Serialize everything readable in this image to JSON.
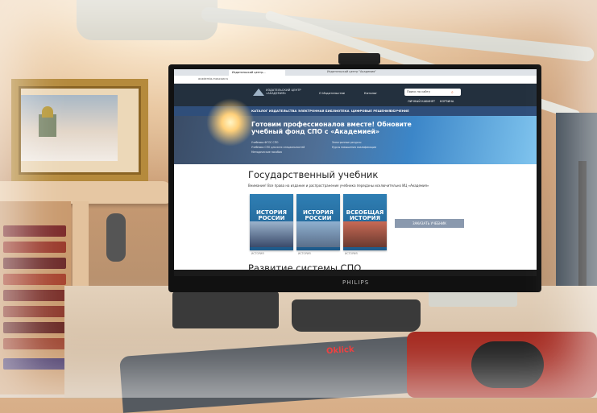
{
  "browser": {
    "tab_label": "Издательский центр...",
    "window_title": "Издательский центр \"Академия\"",
    "address": "academia-moscow.ru"
  },
  "site": {
    "logo_text": "ИЗДАТЕЛЬСКИЙ ЦЕНТР «АКАДЕМИЯ»",
    "header_links": [
      "О Издательстве",
      "Каталог"
    ],
    "search_placeholder": "Поиск по сайту",
    "account_links": [
      "ЛИЧНЫЙ КАБИНЕТ",
      "КОРЗИНА"
    ],
    "nav": [
      "КАТАЛОГ ИЗДАТЕЛЬСТВА",
      "ЭЛЕКТРОННАЯ БИБЛИОТЕКА",
      "ЦИФРОВЫЕ РЕШЕНИЯ",
      "ОБУЧЕНИЕ"
    ],
    "hero_title": "Готовим профессионалов вместе! Обновите учебный фонд СПО с «Академией»",
    "hero_bullets": [
      "Учебники ФГОС СПО",
      "Учебники СПО для всех специальностей",
      "Методические пособия",
      "Электронные ресурсы",
      "Курсы повышения квалификации"
    ],
    "section_title": "Государственный учебник",
    "notice": "Внимание! Все права на издание и распространение учебника переданы исключительно ИЦ «Академия»",
    "books": [
      {
        "title": "ИСТОРИЯ РОССИИ",
        "caption": "ИСТОРИЯ"
      },
      {
        "title": "ИСТОРИЯ РОССИИ",
        "caption": "ИСТОРИЯ"
      },
      {
        "title": "ВСЕОБЩАЯ ИСТОРИЯ",
        "caption": "ИСТОРИЯ"
      }
    ],
    "order_button": "ЗАКАЗАТЬ УЧЕБНИК",
    "section2_title": "Развитие системы СПО"
  },
  "monitor_brand": "PHILIPS",
  "keyboard_brand": "Oklick",
  "colors": {
    "header": "#23303e",
    "nav": "#2f4e7a",
    "button": "#8a99ae"
  }
}
